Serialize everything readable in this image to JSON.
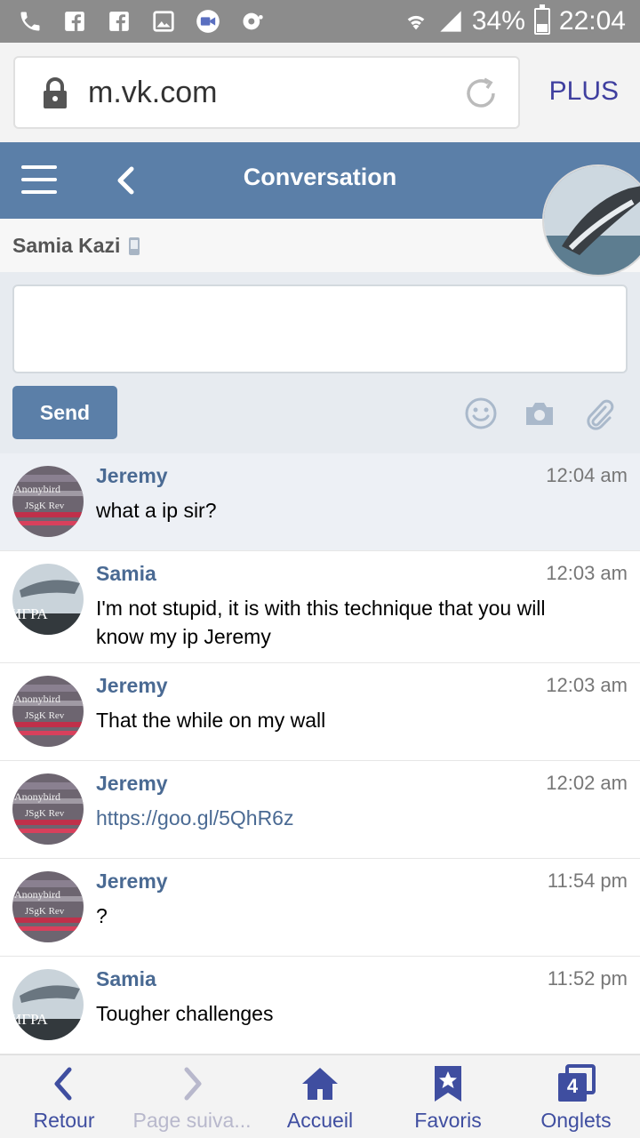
{
  "status_bar": {
    "battery": "34%",
    "time": "22:04",
    "icons": [
      "phone-icon",
      "facebook-icon",
      "facebook-icon",
      "gallery-icon",
      "video-icon",
      "radio-icon",
      "wifi-icon",
      "signal-icon",
      "battery-icon"
    ]
  },
  "browser": {
    "url": "m.vk.com",
    "plus_label": "PLUS"
  },
  "header": {
    "title": "Conversation"
  },
  "contact": {
    "name": "Samia Kazi"
  },
  "composer": {
    "send_label": "Send",
    "message_value": ""
  },
  "messages": [
    {
      "author": "Jeremy",
      "time": "12:04 am",
      "text": "what a ip sir?",
      "unread": true
    },
    {
      "author": "Samia",
      "time": "12:03 am",
      "text": "I'm not stupid, it is with this technique that you will know my ip Jeremy",
      "unread": false
    },
    {
      "author": "Jeremy",
      "time": "12:03 am",
      "text": "That the while on my wall",
      "unread": false
    },
    {
      "author": "Jeremy",
      "time": "12:02 am",
      "text": "https://goo.gl/5QhR6z",
      "unread": false
    },
    {
      "author": "Jeremy",
      "time": "11:54 pm",
      "text": "?",
      "unread": false
    },
    {
      "author": "Samia",
      "time": "11:52 pm",
      "text": "Tougher challenges",
      "unread": false
    }
  ],
  "avatars": {
    "jeremy_text_1": "Anonybird",
    "jeremy_text_2": "JSgK Rev",
    "samia_text": "ИГРА"
  },
  "bottom_nav": {
    "back": "Retour",
    "next": "Page suiva...",
    "home": "Accueil",
    "favorites": "Favoris",
    "tabs": "Onglets",
    "tabs_count": "4"
  },
  "colors": {
    "vk_blue": "#5b7fa8",
    "nav_purple": "#3f4ea0",
    "status_grey": "#8c8c8c"
  }
}
